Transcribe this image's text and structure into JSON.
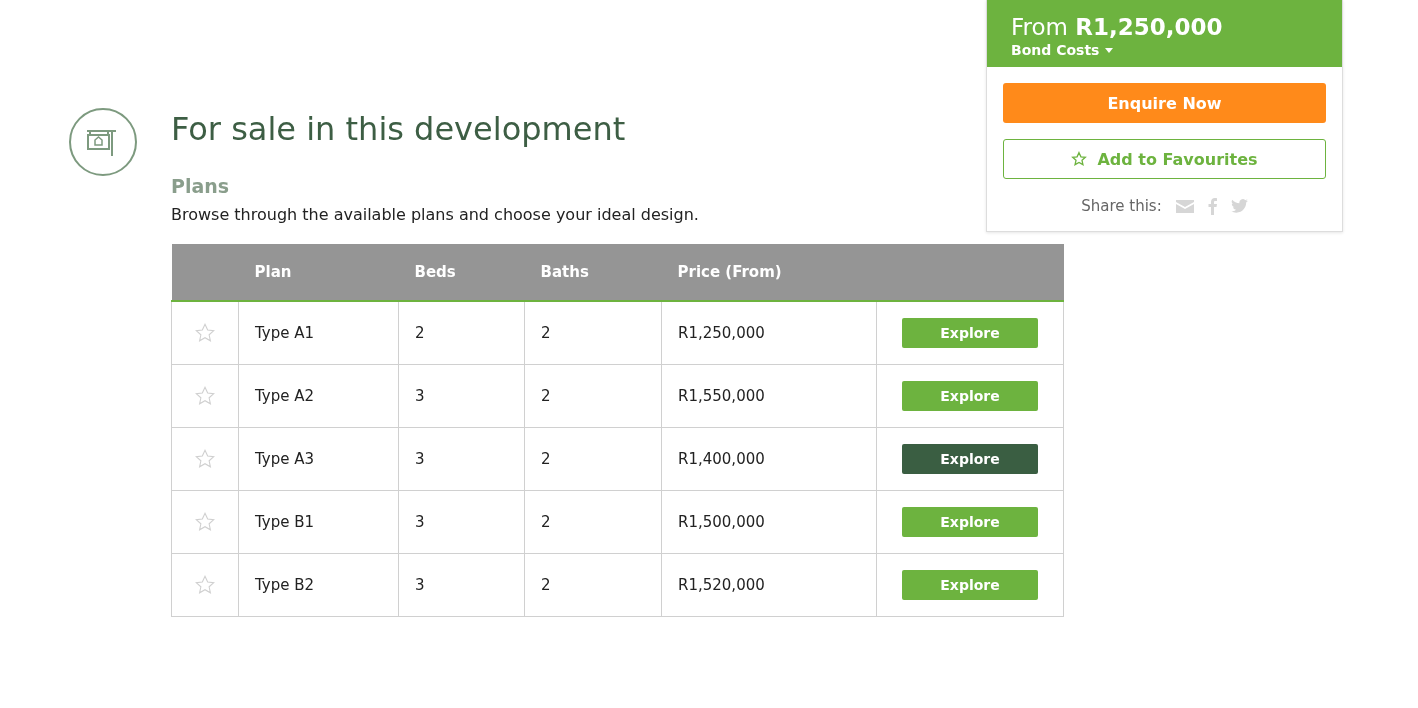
{
  "section": {
    "title": "For sale in this development",
    "subtitle": "Plans",
    "description": "Browse through the available plans and choose your ideal design."
  },
  "table": {
    "columns": [
      "Plan",
      "Beds",
      "Baths",
      "Price (From)"
    ],
    "rows": [
      {
        "favourite": false,
        "plan": "Type A1",
        "beds": "2",
        "baths": "2",
        "price": "R1,250,000",
        "action": "Explore",
        "highlighted": false
      },
      {
        "favourite": false,
        "plan": "Type A2",
        "beds": "3",
        "baths": "2",
        "price": "R1,550,000",
        "action": "Explore",
        "highlighted": false
      },
      {
        "favourite": false,
        "plan": "Type A3",
        "beds": "3",
        "baths": "2",
        "price": "R1,400,000",
        "action": "Explore",
        "highlighted": true
      },
      {
        "favourite": false,
        "plan": "Type B1",
        "beds": "3",
        "baths": "2",
        "price": "R1,500,000",
        "action": "Explore",
        "highlighted": false
      },
      {
        "favourite": false,
        "plan": "Type B2",
        "beds": "3",
        "baths": "2",
        "price": "R1,520,000",
        "action": "Explore",
        "highlighted": false
      }
    ]
  },
  "sidebar": {
    "price": "From **R1,250,000**",
    "bond_costs": "Bond Costs",
    "enquire": "Enquire Now",
    "favourite": "Add to Favourites",
    "share_label": "Share this:"
  }
}
